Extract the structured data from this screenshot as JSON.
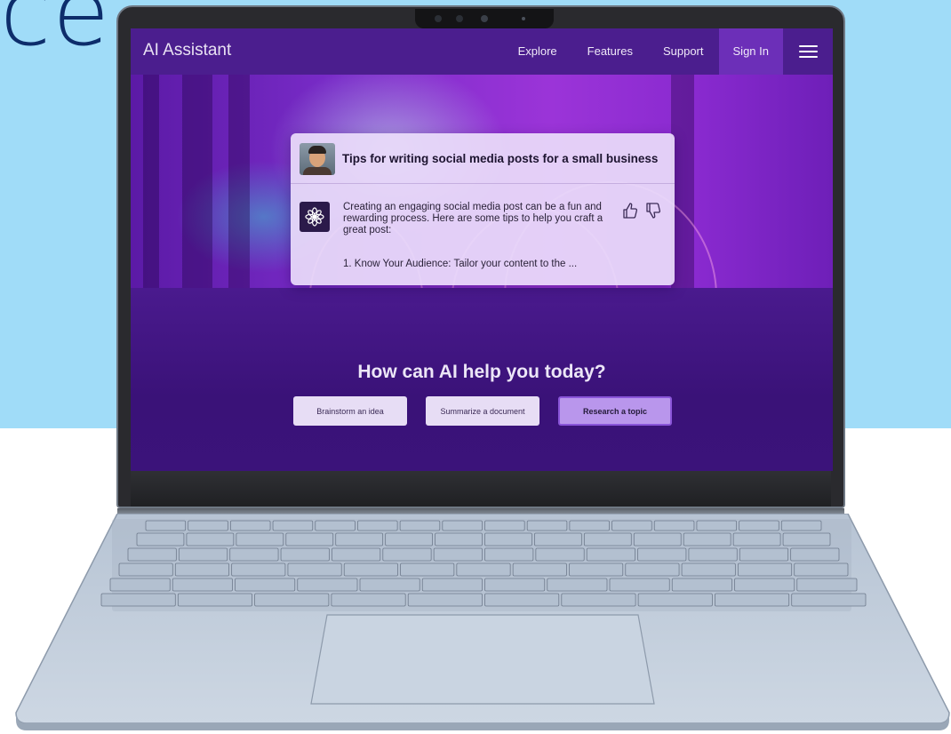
{
  "background": {
    "headline_fragment": "ce",
    "colors": {
      "sky": "#a0dcf8",
      "text": "#0d2d6b"
    }
  },
  "app": {
    "brand": "AI Assistant",
    "nav": [
      {
        "label": "Explore"
      },
      {
        "label": "Features"
      },
      {
        "label": "Support"
      },
      {
        "label": "Sign In"
      }
    ],
    "menu_icon": "hamburger-menu-icon"
  },
  "chat": {
    "prompt": "Tips for writing social media posts for a small business",
    "response": "Creating an engaging social media post can be a fun and rewarding process. Here are some tips to help you craft a great post:",
    "list_item": "1.  Know Your Audience: Tailor your content to the ...",
    "feedback_icons": [
      "thumbs-up-icon",
      "thumbs-down-icon"
    ]
  },
  "main": {
    "headline": "How can AI help you today?",
    "actions": [
      {
        "label": "Brainstorm an idea"
      },
      {
        "label": "Summarize a document"
      },
      {
        "label": "Research a topic"
      }
    ]
  },
  "colors": {
    "navbar": "#4b1e8e",
    "accent": "#6c2fb8",
    "primary_button": "#b996ec"
  }
}
